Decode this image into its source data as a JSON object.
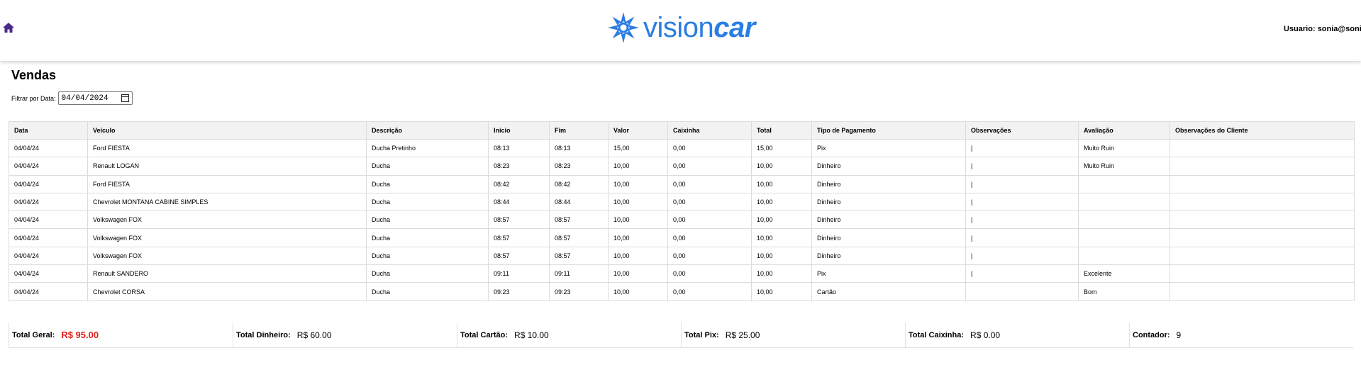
{
  "header": {
    "home_icon": "home-icon",
    "logo_text_light": "vision",
    "logo_text_bold": "car",
    "logo_color": "#2a7de1",
    "user_label": "Usuario:",
    "user_value": "sonia@sonia"
  },
  "page": {
    "title": "Vendas",
    "filter_label": "Filtrar por Data:",
    "filter_value": "04/04/2024"
  },
  "table": {
    "columns": [
      "Data",
      "Veículo",
      "Descrição",
      "Início",
      "Fim",
      "Valor",
      "Caixinha",
      "Total",
      "Tipo de Pagamento",
      "Observações",
      "Avaliação",
      "Observações do Cliente"
    ],
    "rows": [
      [
        "04/04/24",
        "Ford FIESTA",
        "Ducha Pretinho",
        "08:13",
        "08:13",
        "15,00",
        "0,00",
        "15,00",
        "Pix",
        "|",
        "Muito Ruin",
        ""
      ],
      [
        "04/04/24",
        "Renault LOGAN",
        "Ducha",
        "08:23",
        "08:23",
        "10,00",
        "0,00",
        "10,00",
        "Dinheiro",
        "|",
        "Muito Ruin",
        ""
      ],
      [
        "04/04/24",
        "Ford FIESTA",
        "Ducha",
        "08:42",
        "08:42",
        "10,00",
        "0,00",
        "10,00",
        "Dinheiro",
        "|",
        "",
        ""
      ],
      [
        "04/04/24",
        "Chevrolet MONTANA CABINE SIMPLES",
        "Ducha",
        "08:44",
        "08:44",
        "10,00",
        "0,00",
        "10,00",
        "Dinheiro",
        "|",
        "",
        ""
      ],
      [
        "04/04/24",
        "Volkswagen FOX",
        "Ducha",
        "08:57",
        "08:57",
        "10,00",
        "0,00",
        "10,00",
        "Dinheiro",
        "|",
        "",
        ""
      ],
      [
        "04/04/24",
        "Volkswagen FOX",
        "Ducha",
        "08:57",
        "08:57",
        "10,00",
        "0,00",
        "10,00",
        "Dinheiro",
        "|",
        "",
        ""
      ],
      [
        "04/04/24",
        "Volkswagen FOX",
        "Ducha",
        "08:57",
        "08:57",
        "10,00",
        "0,00",
        "10,00",
        "Dinheiro",
        "|",
        "",
        ""
      ],
      [
        "04/04/24",
        "Renault SANDERO",
        "Ducha",
        "09:11",
        "09:11",
        "10,00",
        "0,00",
        "10,00",
        "Pix",
        "|",
        "Excelente",
        ""
      ],
      [
        "04/04/24",
        "Chevrolet CORSA",
        "Ducha",
        "09:23",
        "09:23",
        "10,00",
        "0,00",
        "10,00",
        "Cartão",
        "",
        "Bom",
        ""
      ]
    ]
  },
  "totals": [
    {
      "label": "Total Geral:",
      "value": "R$ 95.00",
      "highlight": "#e0201c"
    },
    {
      "label": "Total Dinheiro:",
      "value": "R$ 60.00"
    },
    {
      "label": "Total Cartão:",
      "value": "R$ 10.00"
    },
    {
      "label": "Total Pix:",
      "value": "R$ 25.00"
    },
    {
      "label": "Total Caixinha:",
      "value": "R$ 0.00"
    },
    {
      "label": "Contador:",
      "value": "9"
    }
  ]
}
